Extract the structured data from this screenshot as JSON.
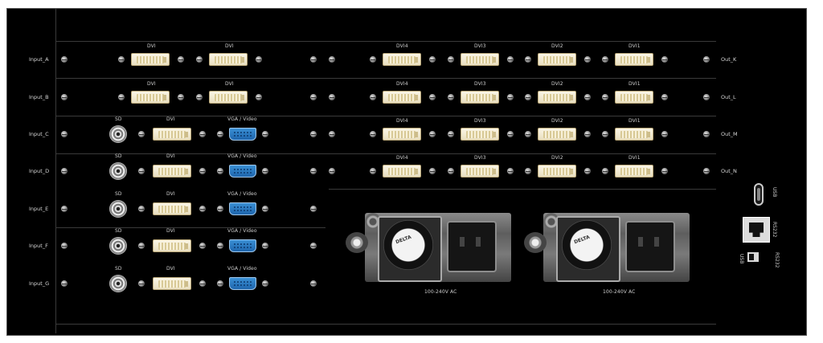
{
  "input_rows": [
    {
      "label": "Input_A"
    },
    {
      "label": "Input_B"
    },
    {
      "label": "Input_C"
    },
    {
      "label": "Input_D"
    },
    {
      "label": "Input_E"
    },
    {
      "label": "Input_F"
    },
    {
      "label": "Input_G"
    }
  ],
  "output_rows": [
    {
      "label": "Out_K"
    },
    {
      "label": "Out_L"
    },
    {
      "label": "Out_M"
    },
    {
      "label": "Out_N"
    }
  ],
  "port_labels": {
    "dvi": "DVI",
    "sd": "SD",
    "vga_video": "VGA / Video",
    "out_dvi": [
      "DVI4",
      "DVI3",
      "DVI2",
      "DVI1"
    ]
  },
  "power_supplies": [
    {
      "label": "100-240V AC",
      "fan_brand": "DELTA"
    },
    {
      "label": "100-240V AC",
      "fan_brand": "DELTA"
    }
  ],
  "side_ports": {
    "usb_label": "USB",
    "rs232_label": "RS232",
    "switch_left_label": "USB",
    "switch_right_label": "RS232"
  },
  "colors": {
    "panel": "#000000",
    "dvi": "#f3ecd2",
    "vga": "#2a7cc6"
  }
}
